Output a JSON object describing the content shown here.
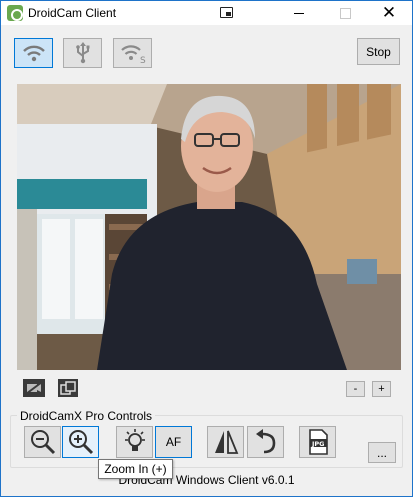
{
  "window": {
    "title": "DroidCam Client",
    "minimize_icon": "minimize-icon",
    "maximize_icon": "maximize-icon",
    "close_glyph": "✕"
  },
  "connection": {
    "wifi_icon": "wifi-icon",
    "usb_icon": "usb-icon",
    "wifi_server_icon": "wifi-server-icon",
    "wifi_server_letter": "S",
    "stop_label": "Stop"
  },
  "video_controls": {
    "video_off_icon": "video-off-icon",
    "popout_icon": "popout-icon",
    "zoom_out_label": "-",
    "zoom_in_label": "+"
  },
  "pro_controls": {
    "group_label": "DroidCamX Pro Controls",
    "buttons": {
      "zoom_out_icon": "zoom-out-icon",
      "zoom_in_icon": "zoom-in-icon",
      "light_icon": "light-bulb-icon",
      "af_label": "AF",
      "mirror_icon": "mirror-icon",
      "rotate_icon": "rotate-icon",
      "jpg_icon": "jpg-icon",
      "jpg_label": "JPG"
    },
    "more_label": "..."
  },
  "tooltip": "Zoom In (+)",
  "footer": "DroidCam Windows Client v6.0.1",
  "colors": {
    "accent": "#0078d7",
    "active_bg": "#cce4f7",
    "button_bg": "#e1e1e1",
    "window_bg": "#f0f0f0",
    "border_blue": "#1e73c9"
  }
}
